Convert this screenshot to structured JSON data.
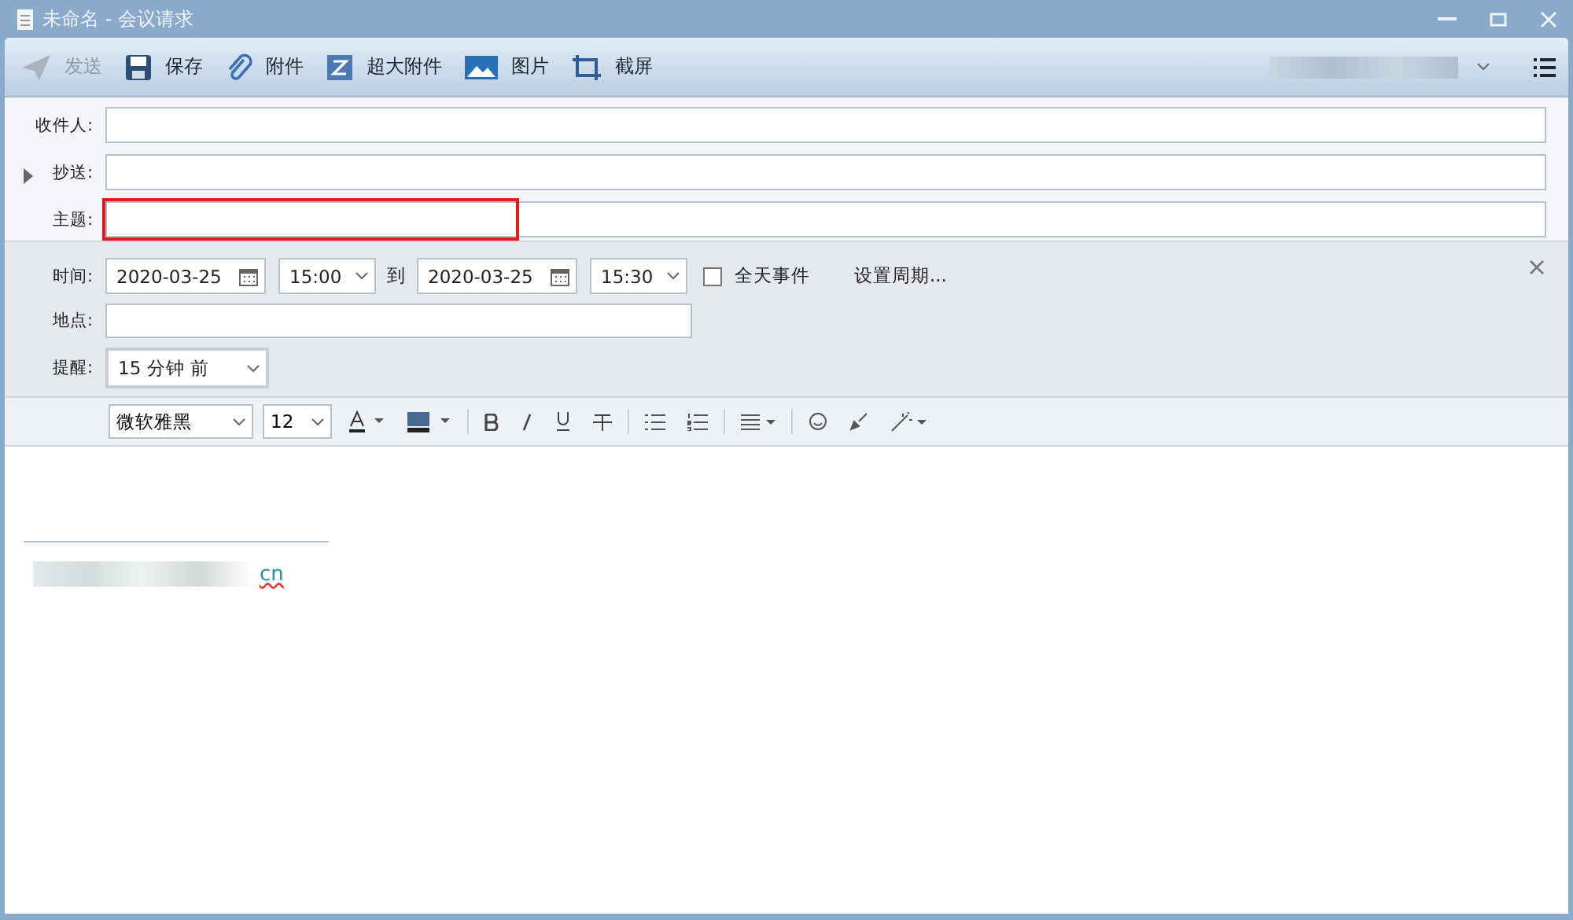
{
  "window": {
    "title": "未命名 - 会议请求"
  },
  "toolbar": [
    {
      "kind": "send",
      "label": "发送",
      "disabled": true
    },
    {
      "kind": "save",
      "label": "保存",
      "disabled": false
    },
    {
      "kind": "attach",
      "label": "附件",
      "disabled": false
    },
    {
      "kind": "bigattach",
      "label": "超大附件",
      "disabled": false
    },
    {
      "kind": "image",
      "label": "图片",
      "disabled": false
    },
    {
      "kind": "screenshot",
      "label": "截屏",
      "disabled": false
    }
  ],
  "address": [
    {
      "kind": "to",
      "label": "收件人:",
      "highlighted": false
    },
    {
      "kind": "cc",
      "label": "抄送:",
      "expanded": false,
      "highlighted": false
    },
    {
      "kind": "subject",
      "label": "主题:",
      "highlighted": true
    }
  ],
  "meeting": {
    "time_label": "时间:",
    "start_date": "2020-03-25",
    "start_time": "15:00",
    "to_label": "到",
    "end_date": "2020-03-25",
    "end_time": "15:30",
    "all_day": {
      "label": "全天事件",
      "checked": false
    },
    "recurrence": "设置周期...",
    "location_label": "地点:",
    "reminder_label": "提醒:",
    "reminder": "15 分钟 前"
  },
  "format": {
    "font": "微软雅黑",
    "size": "12"
  },
  "signature": {
    "visible_text": "cn"
  }
}
